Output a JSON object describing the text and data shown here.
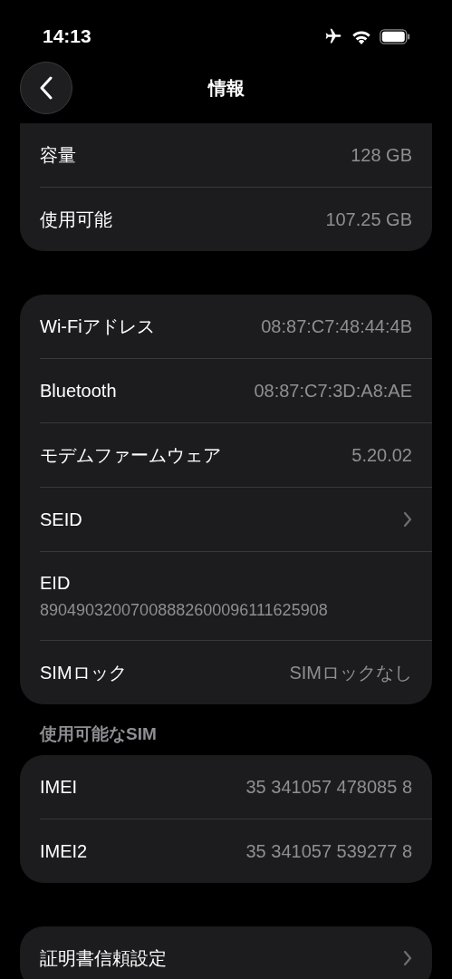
{
  "status_bar": {
    "time": "14:13"
  },
  "nav": {
    "title": "情報"
  },
  "groups": [
    {
      "rows": [
        {
          "kind": "value",
          "label": "容量",
          "value": "128 GB"
        },
        {
          "kind": "value",
          "label": "使用可能",
          "value": "107.25 GB"
        }
      ]
    },
    {
      "rows": [
        {
          "kind": "value",
          "label": "Wi-Fiアドレス",
          "value": "08:87:C7:48:44:4B"
        },
        {
          "kind": "value",
          "label": "Bluetooth",
          "value": "08:87:C7:3D:A8:AE"
        },
        {
          "kind": "value",
          "label": "モデムファームウェア",
          "value": "5.20.02"
        },
        {
          "kind": "chevron",
          "label": "SEID"
        },
        {
          "kind": "subtitle",
          "label": "EID",
          "value": "89049032007008882600096111625908"
        },
        {
          "kind": "value",
          "label": "SIMロック",
          "value": "SIMロックなし"
        }
      ]
    },
    {
      "header": "使用可能なSIM",
      "rows": [
        {
          "kind": "value",
          "label": "IMEI",
          "value": "35 341057 478085 8"
        },
        {
          "kind": "value",
          "label": "IMEI2",
          "value": "35 341057 539277 8"
        }
      ]
    },
    {
      "rows": [
        {
          "kind": "chevron",
          "label": "証明書信頼設定"
        }
      ]
    }
  ]
}
